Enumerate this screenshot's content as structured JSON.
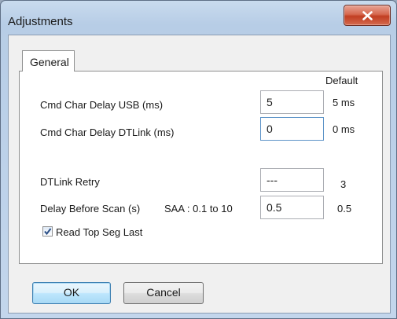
{
  "window": {
    "title": "Adjustments"
  },
  "tabs": [
    {
      "label": "General"
    }
  ],
  "defaults_header": "Default",
  "settings": {
    "cmd_char_delay_usb": {
      "label": "Cmd Char Delay USB (ms)",
      "value": "5",
      "default": "5 ms"
    },
    "cmd_char_delay_dtlink": {
      "label": "Cmd Char Delay DTLink (ms)",
      "value": "0",
      "default": "0 ms"
    },
    "dtlink_retry": {
      "label": "DTLink Retry",
      "value": "---",
      "default": "3"
    },
    "delay_before_scan": {
      "label": "Delay Before Scan (s)",
      "range": "SAA : 0.1 to 10",
      "value": "0.5",
      "default": "0.5"
    },
    "read_top_seg_last": {
      "label": "Read Top Seg Last",
      "checked": true
    }
  },
  "buttons": {
    "ok": "OK",
    "cancel": "Cancel"
  },
  "icons": {
    "close": "close-icon",
    "checkmark": "checkmark-icon"
  },
  "colors": {
    "title_bar": "#b7cde6",
    "close_button": "#c13e22",
    "focus_border": "#5c93c8",
    "default_button": "#bee6fd"
  }
}
